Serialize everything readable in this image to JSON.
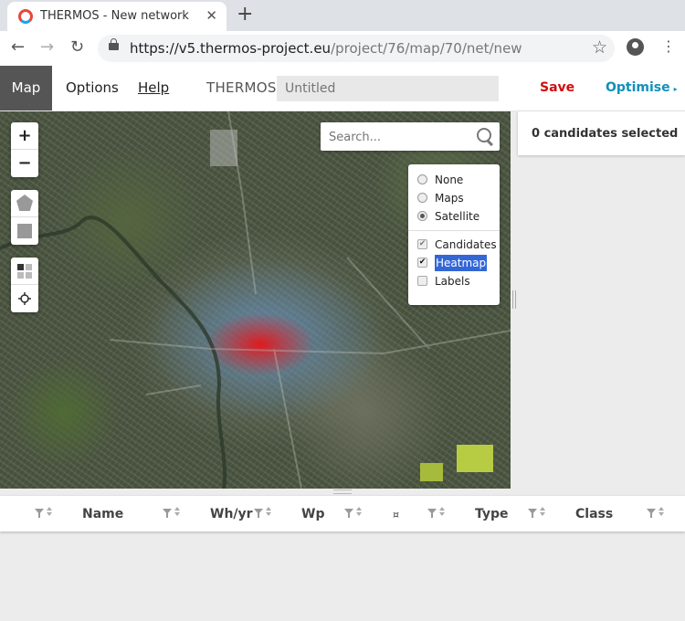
{
  "browser": {
    "tab_title": "THERMOS - New network",
    "tab_close": "✕",
    "new_tab": "+",
    "url_host": "https://v5.thermos-project.eu",
    "url_path": "/project/76/map/70/net/new"
  },
  "appbar": {
    "tabs": [
      "Map",
      "Options",
      "Help"
    ],
    "brand": "THERMOS",
    "name_placeholder": "Untitled",
    "save_label": "Save",
    "optimise_label": "Optimise",
    "optimise_caret": "▸"
  },
  "map": {
    "zoom_in": "+",
    "zoom_out": "−",
    "search_placeholder": "Search...",
    "layers": {
      "basemaps": [
        {
          "label": "None",
          "selected": false
        },
        {
          "label": "Maps",
          "selected": false
        },
        {
          "label": "Satellite",
          "selected": true
        }
      ],
      "overlays": [
        {
          "label": "Candidates",
          "checked": true
        },
        {
          "label": "Heatmap",
          "checked": true
        },
        {
          "label": "Labels",
          "checked": false
        }
      ]
    }
  },
  "sidepanel": {
    "selection_status": "0 candidates selected"
  },
  "table": {
    "columns": [
      "Name",
      "Wh/yr",
      "Wp",
      "¤",
      "Type",
      "Class"
    ]
  }
}
